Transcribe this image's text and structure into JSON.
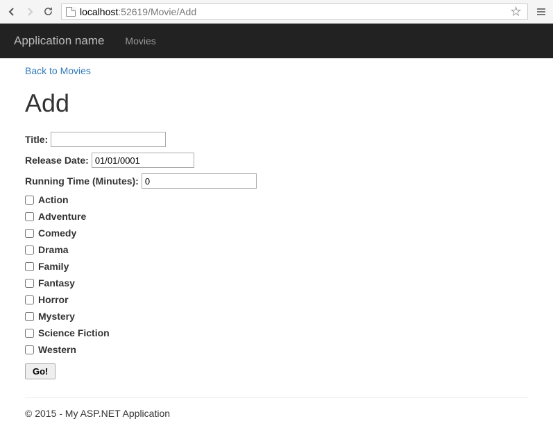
{
  "browser": {
    "url_host": "localhost",
    "url_port": ":52619",
    "url_path": "/Movie/Add"
  },
  "navbar": {
    "brand": "Application name",
    "link_movies": "Movies"
  },
  "page": {
    "back_link": "Back to Movies",
    "heading": "Add"
  },
  "form": {
    "title_label": "Title:",
    "title_value": "",
    "release_label": "Release Date:",
    "release_value": "01/01/0001",
    "runtime_label": "Running Time (Minutes):",
    "runtime_value": "0",
    "genres": [
      "Action",
      "Adventure",
      "Comedy",
      "Drama",
      "Family",
      "Fantasy",
      "Horror",
      "Mystery",
      "Science Fiction",
      "Western"
    ],
    "submit_label": "Go!"
  },
  "footer": {
    "text": "© 2015 - My ASP.NET Application"
  }
}
